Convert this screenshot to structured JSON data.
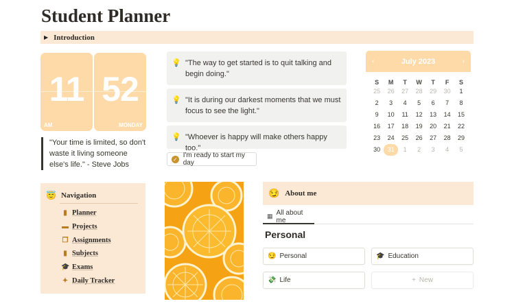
{
  "page": {
    "title": "Student Planner"
  },
  "intro": {
    "label": "Introduction"
  },
  "clock": {
    "hour": "11",
    "minute": "52",
    "ampm": "AM",
    "weekday": "MONDAY"
  },
  "jobs_quote": "\"Your time is limited, so don't waste it living someone else's life.\" - Steve Jobs",
  "quotes": [
    "\"The way to get started is to quit talking and begin doing.\"",
    "\"It is during our darkest moments that we must focus to see the light.\"",
    "\"Whoever is happy will make others happy too.\""
  ],
  "ready_button": "I'm ready to start my day",
  "calendar": {
    "month": "July 2023",
    "prev": "‹",
    "next": "›",
    "dow": [
      "S",
      "M",
      "T",
      "W",
      "T",
      "F",
      "S"
    ],
    "weeks": [
      [
        "25",
        "26",
        "27",
        "28",
        "29",
        "30",
        "1"
      ],
      [
        "2",
        "3",
        "4",
        "5",
        "6",
        "7",
        "8"
      ],
      [
        "9",
        "10",
        "11",
        "12",
        "13",
        "14",
        "15"
      ],
      [
        "16",
        "17",
        "18",
        "19",
        "20",
        "21",
        "22"
      ],
      [
        "23",
        "24",
        "25",
        "26",
        "27",
        "28",
        "29"
      ],
      [
        "30",
        "31",
        "1",
        "2",
        "3",
        "4",
        "5"
      ]
    ],
    "today": "31"
  },
  "navigation": {
    "title": "Navigation",
    "items": [
      {
        "label": "Planner",
        "icon": "book-icon"
      },
      {
        "label": "Projects",
        "icon": "monitor-icon"
      },
      {
        "label": "Assignments",
        "icon": "documents-icon"
      },
      {
        "label": "Subjects",
        "icon": "notebook-icon"
      },
      {
        "label": "Exams",
        "icon": "graduation-cap-icon"
      },
      {
        "label": "Daily Tracker",
        "icon": "magic-wand-icon"
      }
    ]
  },
  "about": {
    "title": "About me",
    "tab": "All about me",
    "section": "Personal",
    "cards": {
      "personal": "Personal",
      "education": "Education",
      "life": "Life",
      "new": "New"
    }
  },
  "colors": {
    "peach": "#fbe9d6",
    "clock": "#fddaa8",
    "quote_bg": "#f1f1ef",
    "accent": "#c9932a"
  }
}
